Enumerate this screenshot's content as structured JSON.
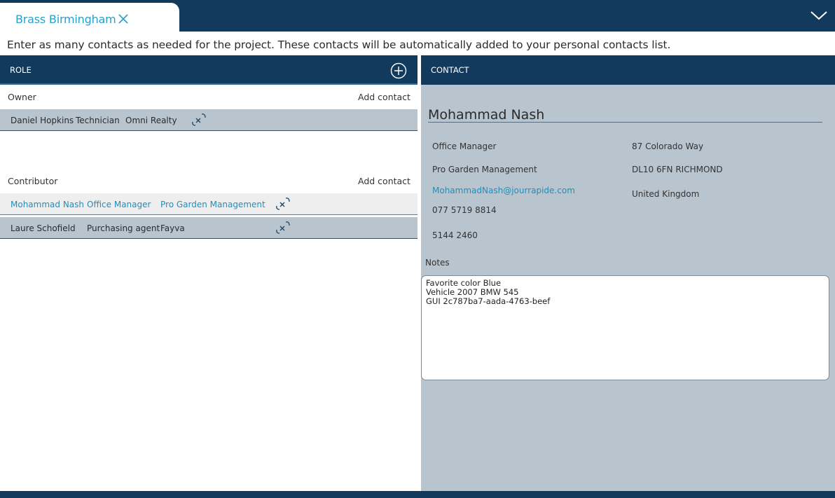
{
  "tab": {
    "title": "Brass Birmingham"
  },
  "instructions": "Enter as many contacts as needed for the project. These contacts will be automatically added to your personal contacts list.",
  "role_panel": {
    "header": "ROLE"
  },
  "contact_panel": {
    "header": "CONTACT"
  },
  "sections": [
    {
      "label": "Owner",
      "add_label": "Add contact",
      "rows": [
        {
          "name": "Daniel Hopkins",
          "title": "Technician",
          "company": "Omni Realty"
        }
      ]
    },
    {
      "label": "Contributor",
      "add_label": "Add contact",
      "rows": [
        {
          "name": "Mohammad Nash",
          "title": "Office Manager",
          "company": "Pro Garden Management",
          "selected": true
        },
        {
          "name": "Laure Schofield",
          "title": "Purchasing agent",
          "company": "Fayva"
        }
      ]
    }
  ],
  "contact": {
    "name": "Mohammad Nash",
    "title": "Office Manager",
    "company": "Pro Garden Management",
    "email": "MohammadNash@jourrapide.com",
    "phone1": "077 5719 8814",
    "phone2": "5144 2460",
    "address1": "87 Colorado Way",
    "address2": "DL10 6FN RICHMOND",
    "country": "United Kingdom",
    "notes_label": "Notes",
    "notes": "Favorite color Blue\nVehicle 2007 BMW 545\nGUI 2c787ba7-aada-4763-beef"
  },
  "colors": {
    "navy": "#123a5c",
    "accent": "#29a0c8",
    "row_bg": "#b8c4ce",
    "selected_bg": "#eeeeee"
  },
  "icons": {
    "close": "close-icon",
    "collapse": "chevron-down-icon",
    "add": "plus-circle-icon",
    "unlink": "unlink-icon"
  }
}
